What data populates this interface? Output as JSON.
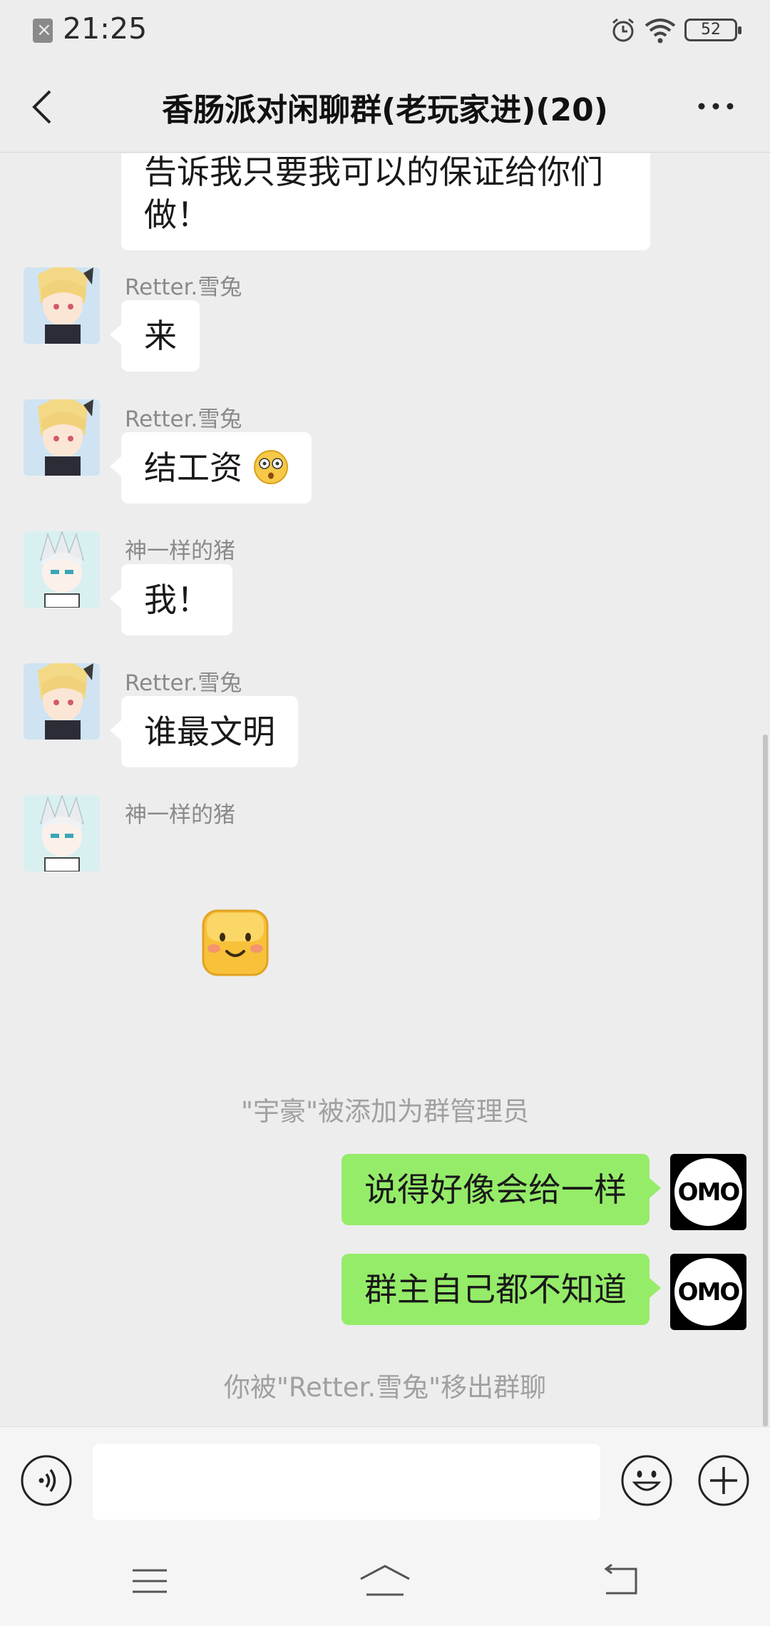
{
  "status_bar": {
    "time": "21:25",
    "battery": "52"
  },
  "header": {
    "title": "香肠派对闲聊群(老玩家进)(20)"
  },
  "messages": [
    {
      "type": "incoming",
      "text": "告诉我只要我可以的保证给你们做！"
    },
    {
      "type": "incoming",
      "sender": "Retter.雪兔",
      "text": "来"
    },
    {
      "type": "incoming",
      "sender": "Retter.雪兔",
      "text": "结工资",
      "emoji": "flushed-face"
    },
    {
      "type": "incoming",
      "sender": "神一样的猪",
      "text": "我！"
    },
    {
      "type": "incoming",
      "sender": "Retter.雪兔",
      "text": "谁最文明"
    },
    {
      "type": "incoming",
      "sender": "神一样的猪",
      "sticker": "smiling-face-sticker"
    },
    {
      "type": "system",
      "text": "\"宇豪\"被添加为群管理员"
    },
    {
      "type": "outgoing",
      "text": "说得好像会给一样",
      "avatar_text": "OMO"
    },
    {
      "type": "outgoing",
      "text": "群主自己都不知道",
      "avatar_text": "OMO"
    },
    {
      "type": "system",
      "text": "你被\"Retter.雪兔\"移出群聊"
    }
  ],
  "input": {
    "value": "",
    "placeholder": ""
  },
  "colors": {
    "background": "#ededed",
    "outgoing_bubble": "#95ec69",
    "incoming_bubble": "#ffffff"
  }
}
